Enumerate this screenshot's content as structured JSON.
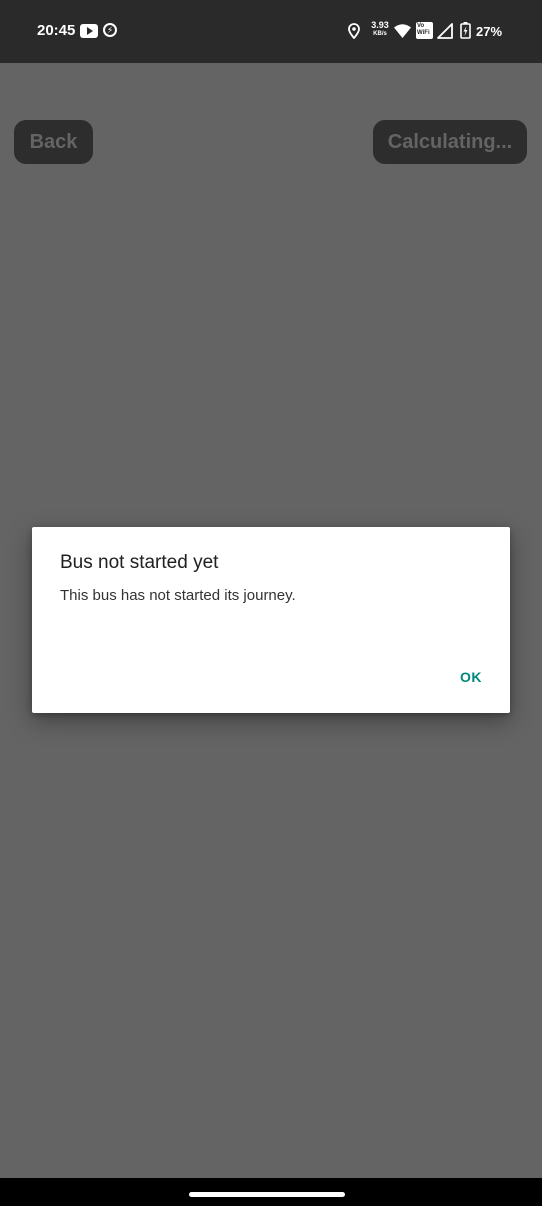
{
  "status_bar": {
    "time": "20:45",
    "net_speed_value": "3.93",
    "net_speed_unit": "KB/s",
    "vowifi_line1": "Vo",
    "vowifi_line2": "WiFi",
    "battery_percent": "27%",
    "icons": [
      "youtube-icon",
      "charging-bolt-icon",
      "location-icon",
      "wifi-icon",
      "vowifi-icon",
      "signal-icon",
      "battery-icon"
    ]
  },
  "toolbar": {
    "back_label": "Back",
    "calculating_label": "Calculating..."
  },
  "dialog": {
    "title": "Bus not started yet",
    "message": "This bus has not started its journey.",
    "ok_label": "OK"
  },
  "colors": {
    "scrim_background": "#646464",
    "status_bar": "#2a2a2a",
    "button_background": "#2d2d2d",
    "dialog_accent": "#00897b"
  }
}
